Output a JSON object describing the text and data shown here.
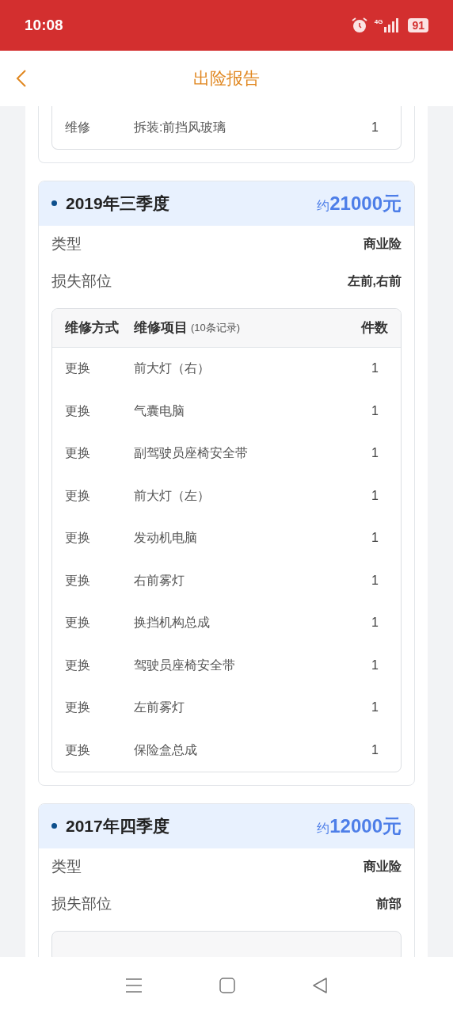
{
  "status_bar": {
    "time": "10:08",
    "network": "4G",
    "battery": "91"
  },
  "header": {
    "title": "出险报告"
  },
  "previous_tail": {
    "rows": [
      {
        "method": "维修",
        "item": "拆装:前挡风玻璃",
        "qty": "1"
      }
    ]
  },
  "records": [
    {
      "period": "2019年三季度",
      "amount_prefix": "约",
      "amount": "21000元",
      "fields": [
        {
          "label": "类型",
          "value": "商业险"
        },
        {
          "label": "损失部位",
          "value": "左前,右前"
        }
      ],
      "table": {
        "columns": [
          "维修方式",
          "维修项目",
          "件数"
        ],
        "count_note": "(10条记录)",
        "rows": [
          {
            "method": "更换",
            "item": "前大灯（右）",
            "qty": "1"
          },
          {
            "method": "更换",
            "item": "气囊电脑",
            "qty": "1"
          },
          {
            "method": "更换",
            "item": "副驾驶员座椅安全带",
            "qty": "1"
          },
          {
            "method": "更换",
            "item": "前大灯（左）",
            "qty": "1"
          },
          {
            "method": "更换",
            "item": "发动机电脑",
            "qty": "1"
          },
          {
            "method": "更换",
            "item": "右前雾灯",
            "qty": "1"
          },
          {
            "method": "更换",
            "item": "换挡机构总成",
            "qty": "1"
          },
          {
            "method": "更换",
            "item": "驾驶员座椅安全带",
            "qty": "1"
          },
          {
            "method": "更换",
            "item": "左前雾灯",
            "qty": "1"
          },
          {
            "method": "更换",
            "item": "保险盒总成",
            "qty": "1"
          }
        ]
      }
    },
    {
      "period": "2017年四季度",
      "amount_prefix": "约",
      "amount": "12000元",
      "fields": [
        {
          "label": "类型",
          "value": "商业险"
        },
        {
          "label": "损失部位",
          "value": "前部"
        }
      ]
    }
  ]
}
